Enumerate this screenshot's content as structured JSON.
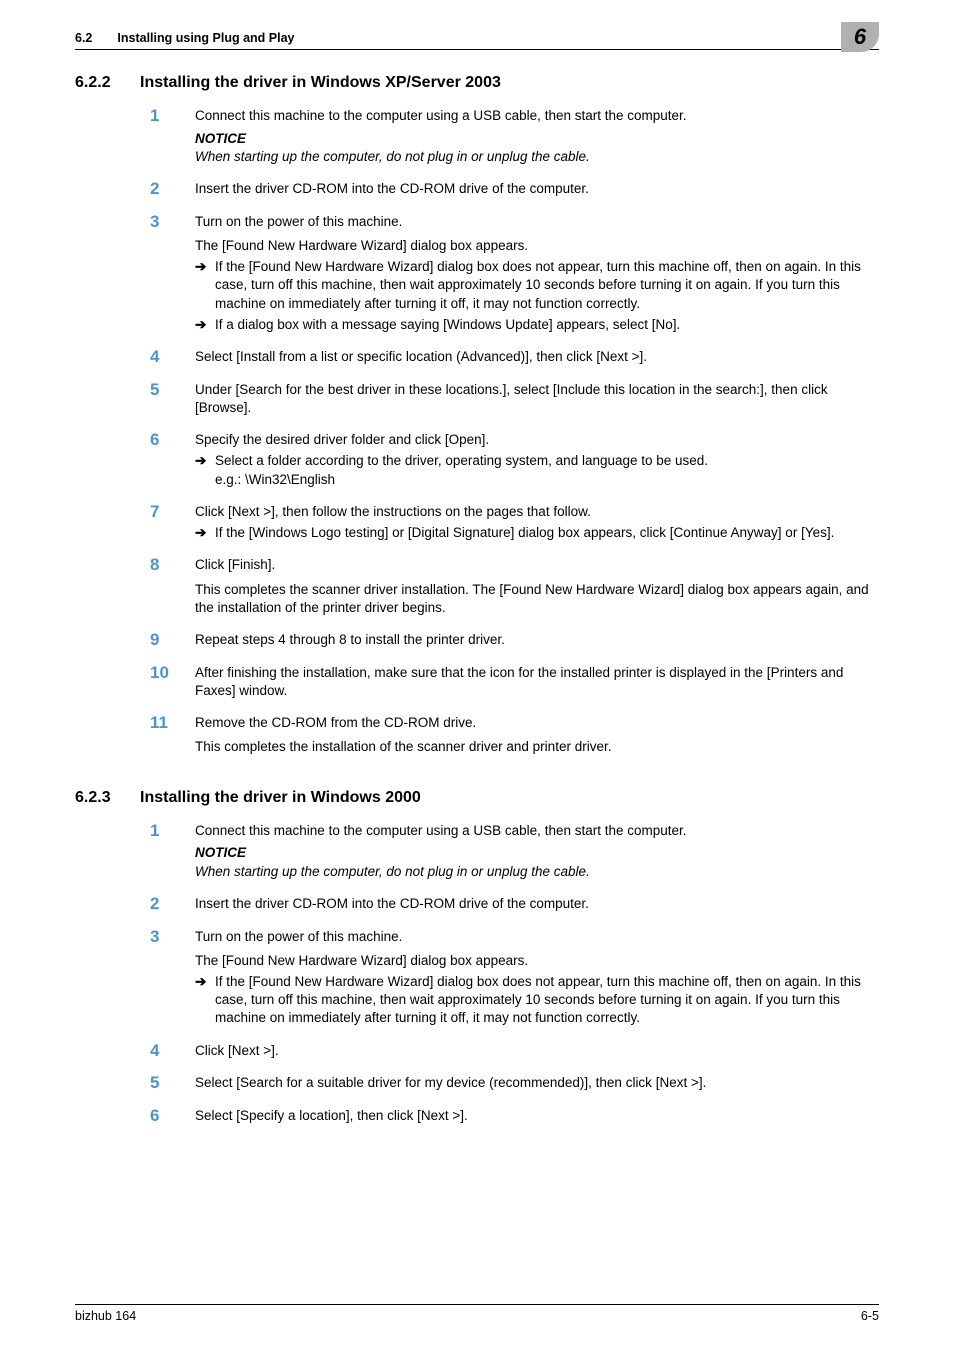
{
  "header": {
    "sec_num": "6.2",
    "sec_title": "Installing using Plug and Play",
    "corner_digit": "6"
  },
  "section_a": {
    "num": "6.2.2",
    "title": "Installing the driver in Windows XP/Server 2003",
    "steps": [
      {
        "n": "1",
        "text": "Connect this machine to the computer using a USB cable, then start the computer.",
        "notice": "NOTICE",
        "notice_body": "When starting up the computer, do not plug in or unplug the cable."
      },
      {
        "n": "2",
        "text": "Insert the driver CD-ROM into the CD-ROM drive of the computer."
      },
      {
        "n": "3",
        "text": "Turn on the power of this machine.",
        "follow": "The [Found New Hardware Wizard] dialog box appears.",
        "subs": [
          "If the [Found New Hardware Wizard] dialog box does not appear, turn this machine off, then on again. In this case, turn off this machine, then wait approximately 10 seconds before turning it on again. If you turn this machine on immediately after turning it off, it may not function correctly.",
          "If a dialog box with a message saying [Windows Update] appears, select [No]."
        ]
      },
      {
        "n": "4",
        "text": "Select [Install from a list or specific location (Advanced)], then click [Next >]."
      },
      {
        "n": "5",
        "text": "Under [Search for the best driver in these locations.], select [Include this location in the search:], then click [Browse]."
      },
      {
        "n": "6",
        "text": "Specify the desired driver folder and click [Open].",
        "subs": [
          "Select a folder according to the driver, operating system, and language to be used.\ne.g.: \\Win32\\English"
        ]
      },
      {
        "n": "7",
        "text": "Click [Next >], then follow the instructions on the pages that follow.",
        "subs": [
          "If the [Windows Logo testing] or [Digital Signature] dialog box appears, click [Continue Anyway] or [Yes]."
        ]
      },
      {
        "n": "8",
        "text": "Click [Finish].",
        "follow": "This completes the scanner driver installation. The [Found New Hardware Wizard] dialog box appears again, and the installation of the printer driver begins."
      },
      {
        "n": "9",
        "text": "Repeat steps 4 through 8 to install the printer driver."
      },
      {
        "n": "10",
        "text": "After finishing the installation, make sure that the icon for the installed printer is displayed in the [Printers and Faxes] window."
      },
      {
        "n": "11",
        "text": "Remove the CD-ROM from the CD-ROM drive.",
        "follow": "This completes the installation of the scanner driver and printer driver."
      }
    ]
  },
  "section_b": {
    "num": "6.2.3",
    "title": "Installing the driver in Windows 2000",
    "steps": [
      {
        "n": "1",
        "text": "Connect this machine to the computer using a USB cable, then start the computer.",
        "notice": "NOTICE",
        "notice_body": "When starting up the computer, do not plug in or unplug the cable."
      },
      {
        "n": "2",
        "text": "Insert the driver CD-ROM into the CD-ROM drive of the computer."
      },
      {
        "n": "3",
        "text": "Turn on the power of this machine.",
        "follow": "The [Found New Hardware Wizard] dialog box appears.",
        "subs": [
          "If the [Found New Hardware Wizard] dialog box does not appear, turn this machine off, then on again. In this case, turn off this machine, then wait approximately 10 seconds before turning it on again. If you turn this machine on immediately after turning it off, it may not function correctly."
        ]
      },
      {
        "n": "4",
        "text": "Click [Next >]."
      },
      {
        "n": "5",
        "text": "Select [Search for a suitable driver for my device (recommended)], then click [Next >]."
      },
      {
        "n": "6",
        "text": "Select [Specify a location], then click [Next >]."
      }
    ]
  },
  "footer": {
    "left": "bizhub 164",
    "right": "6-5"
  },
  "arrow_glyph": "➔"
}
